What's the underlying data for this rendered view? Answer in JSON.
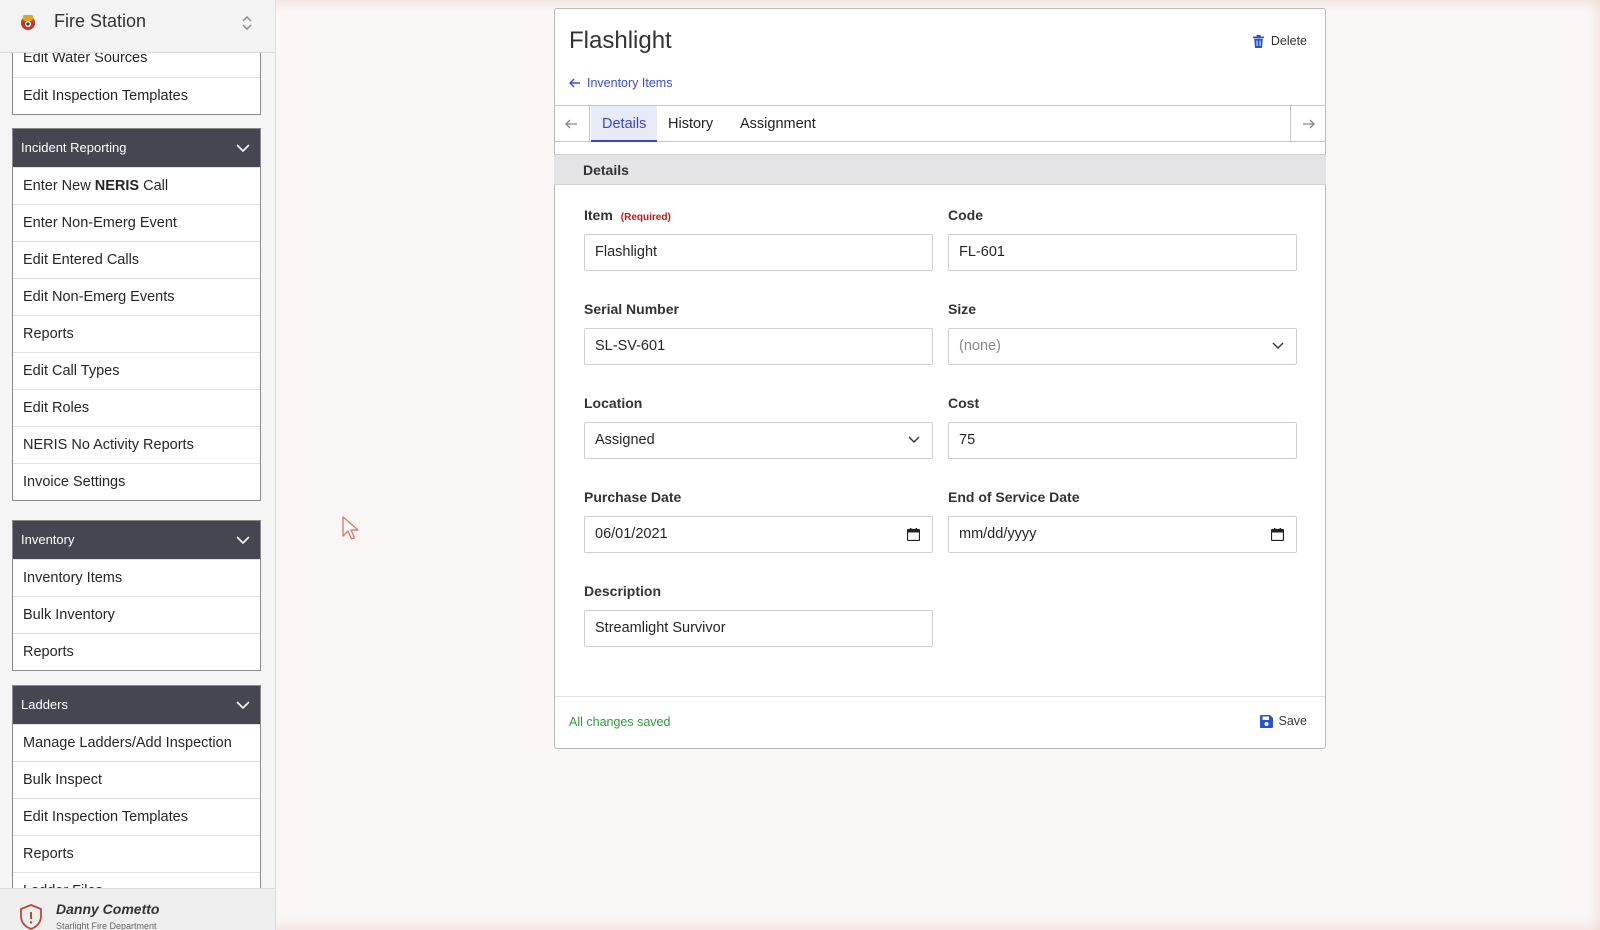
{
  "sidebar": {
    "title": "Fire Station",
    "top_items": [
      "Edit Water Sources",
      "Edit Inspection Templates"
    ],
    "groups": [
      {
        "header": "Incident Reporting",
        "items": [
          {
            "pre": "Enter New ",
            "bold": "NERIS",
            "post": " Call"
          },
          {
            "pre": "Enter Non-Emerg Event"
          },
          {
            "pre": "Edit Entered Calls"
          },
          {
            "pre": "Edit Non-Emerg Events"
          },
          {
            "pre": "Reports"
          },
          {
            "pre": "Edit Call Types"
          },
          {
            "pre": "Edit Roles"
          },
          {
            "pre": "NERIS No Activity Reports"
          },
          {
            "pre": "Invoice Settings"
          }
        ]
      },
      {
        "header": "Inventory",
        "items": [
          {
            "pre": "Inventory Items"
          },
          {
            "pre": "Bulk Inventory"
          },
          {
            "pre": "Reports"
          }
        ]
      },
      {
        "header": "Ladders",
        "items": [
          {
            "pre": "Manage Ladders/Add Inspection"
          },
          {
            "pre": "Bulk Inspect"
          },
          {
            "pre": "Edit Inspection Templates"
          },
          {
            "pre": "Reports"
          },
          {
            "pre": "Ladder Files"
          }
        ]
      }
    ],
    "user": {
      "name": "Danny Cometto",
      "department": "Starlight Fire Department"
    }
  },
  "card": {
    "title": "Flashlight",
    "delete_label": "Delete",
    "back_label": "Inventory Items",
    "tabs": [
      "Details",
      "History",
      "Assignment"
    ],
    "section_title": "Details",
    "fields": {
      "item": {
        "label": "Item",
        "required": "(Required)",
        "value": "Flashlight"
      },
      "code": {
        "label": "Code",
        "value": "FL-601"
      },
      "serial": {
        "label": "Serial Number",
        "value": "SL-SV-601"
      },
      "size": {
        "label": "Size",
        "value": "(none)"
      },
      "location": {
        "label": "Location",
        "value": "Assigned"
      },
      "cost": {
        "label": "Cost",
        "value": "75"
      },
      "purchase_date": {
        "label": "Purchase Date",
        "value": "06/01/2021"
      },
      "end_date": {
        "label": "End of Service Date",
        "value": "mm/dd/yyyy"
      },
      "description": {
        "label": "Description",
        "value": "Streamlight Survivor"
      }
    },
    "status": "All changes saved",
    "save_label": "Save"
  },
  "colors": {
    "accent": "#3a46c9",
    "saved": "#2f9a3a",
    "required": "#c01616",
    "group_header": "#45464f"
  }
}
